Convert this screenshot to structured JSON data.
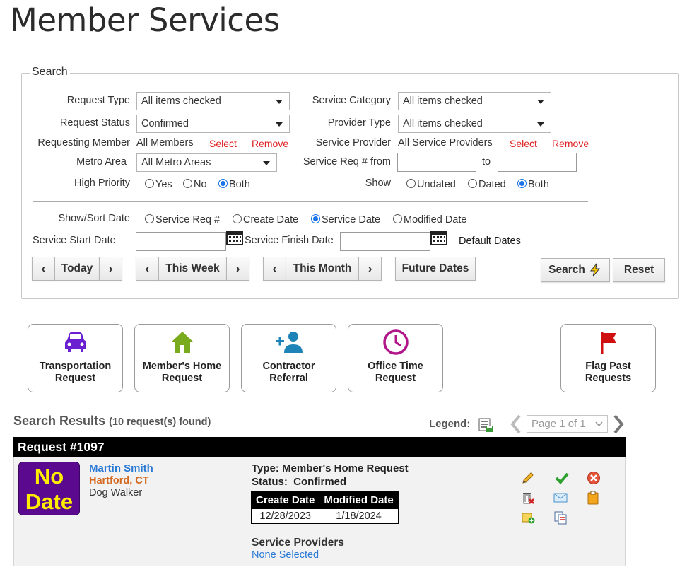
{
  "page": {
    "title": "Member Services"
  },
  "search": {
    "legend": "Search",
    "request_type": {
      "label": "Request Type",
      "value": "All items checked"
    },
    "service_category": {
      "label": "Service Category",
      "value": "All items checked"
    },
    "request_status": {
      "label": "Request Status",
      "value": "Confirmed"
    },
    "provider_type": {
      "label": "Provider Type",
      "value": "All items checked"
    },
    "requesting_member": {
      "label": "Requesting Member",
      "value": "All Members",
      "select": "Select",
      "remove": "Remove"
    },
    "service_provider": {
      "label": "Service Provider",
      "value": "All Service Providers",
      "select": "Select",
      "remove": "Remove"
    },
    "metro_area": {
      "label": "Metro Area",
      "value": "All Metro Areas"
    },
    "service_req_num": {
      "label": "Service Req # from",
      "to": "to",
      "from_value": "",
      "to_value": ""
    },
    "high_priority": {
      "label": "High Priority",
      "options": [
        "Yes",
        "No",
        "Both"
      ],
      "selected": "Both"
    },
    "show": {
      "label": "Show",
      "options": [
        "Undated",
        "Dated",
        "Both"
      ],
      "selected": "Both"
    },
    "show_sort_date": {
      "label": "Show/Sort Date",
      "options": [
        "Service Req #",
        "Create Date",
        "Service Date",
        "Modified Date"
      ],
      "selected": "Service Date"
    },
    "service_start_date": {
      "label": "Service Start Date",
      "value": ""
    },
    "service_finish_date": {
      "label": "Service Finish Date",
      "value": ""
    },
    "default_dates": "Default Dates",
    "buttons": {
      "today": "Today",
      "this_week": "This Week",
      "this_month": "This Month",
      "future_dates": "Future Dates",
      "search": "Search",
      "reset": "Reset"
    }
  },
  "cards": [
    {
      "line1": "Transportation",
      "line2": "Request",
      "icon": "car-icon",
      "color": "#6a1fd0"
    },
    {
      "line1": "Member's Home",
      "line2": "Request",
      "icon": "house-icon",
      "color": "#7aab1e"
    },
    {
      "line1": "Contractor",
      "line2": "Referral",
      "icon": "add-person-icon",
      "color": "#1e84b8"
    },
    {
      "line1": "Office Time",
      "line2": "Request",
      "icon": "clock-icon",
      "color": "#b0168a"
    },
    {
      "line1": "Flag Past",
      "line2": "Requests",
      "icon": "flag-icon",
      "color": "#d01010"
    }
  ],
  "results": {
    "title": "Search Results",
    "count": "(10 request(s) found)",
    "legend_label": "Legend:",
    "pager": "Page 1 of 1"
  },
  "request": {
    "header": "Request #1097",
    "badge_line1": "No",
    "badge_line2": "Date",
    "member_name": "Martin Smith",
    "member_location": "Hartford, CT",
    "member_job": "Dog Walker",
    "type": "Type: Member's Home Request",
    "status": "Status:  Confirmed",
    "dates": {
      "headers": [
        "Create Date",
        "Modified Date"
      ],
      "values": [
        "12/28/2023",
        "1/18/2024"
      ]
    },
    "service_providers_title": "Service Providers",
    "service_providers_value": "None Selected"
  },
  "colors": {
    "link_blue": "#2a7ad6",
    "link_red": "#e02020",
    "location_orange": "#d2691e",
    "badge_purple": "#5b0a8f",
    "badge_text": "#ffee00"
  }
}
